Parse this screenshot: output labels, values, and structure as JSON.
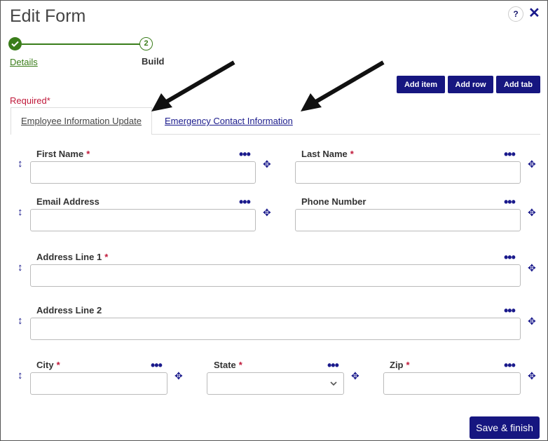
{
  "dialog": {
    "title": "Edit Form",
    "help_label": "?",
    "close_label": "✕"
  },
  "stepper": {
    "steps": [
      {
        "label": "Details",
        "status": "complete"
      },
      {
        "label": "Build",
        "number": "2",
        "status": "current"
      }
    ]
  },
  "toolbar": {
    "add_item": "Add item",
    "add_row": "Add row",
    "add_tab": "Add tab"
  },
  "required_label": "Required*",
  "tabs": [
    {
      "label": "Employee Information Update",
      "active": true
    },
    {
      "label": "Emergency Contact Information",
      "active": false
    }
  ],
  "fields": {
    "first_name": {
      "label": "First Name",
      "required": "*",
      "value": ""
    },
    "last_name": {
      "label": "Last Name",
      "required": "*",
      "value": ""
    },
    "email": {
      "label": "Email Address",
      "value": ""
    },
    "phone": {
      "label": "Phone Number",
      "value": ""
    },
    "address1": {
      "label": "Address Line 1",
      "required": "*",
      "value": ""
    },
    "address2": {
      "label": "Address Line 2",
      "value": ""
    },
    "city": {
      "label": "City",
      "required": "*",
      "value": ""
    },
    "state": {
      "label": "State",
      "required": "*",
      "value": ""
    },
    "zip": {
      "label": "Zip",
      "required": "*",
      "value": ""
    }
  },
  "icons": {
    "more": "•••",
    "drag": "↕",
    "move": "✥"
  },
  "footer": {
    "save_label": "Save & finish"
  },
  "colors": {
    "accent": "#161680",
    "success": "#3a7d1a",
    "required": "#c0193a"
  }
}
